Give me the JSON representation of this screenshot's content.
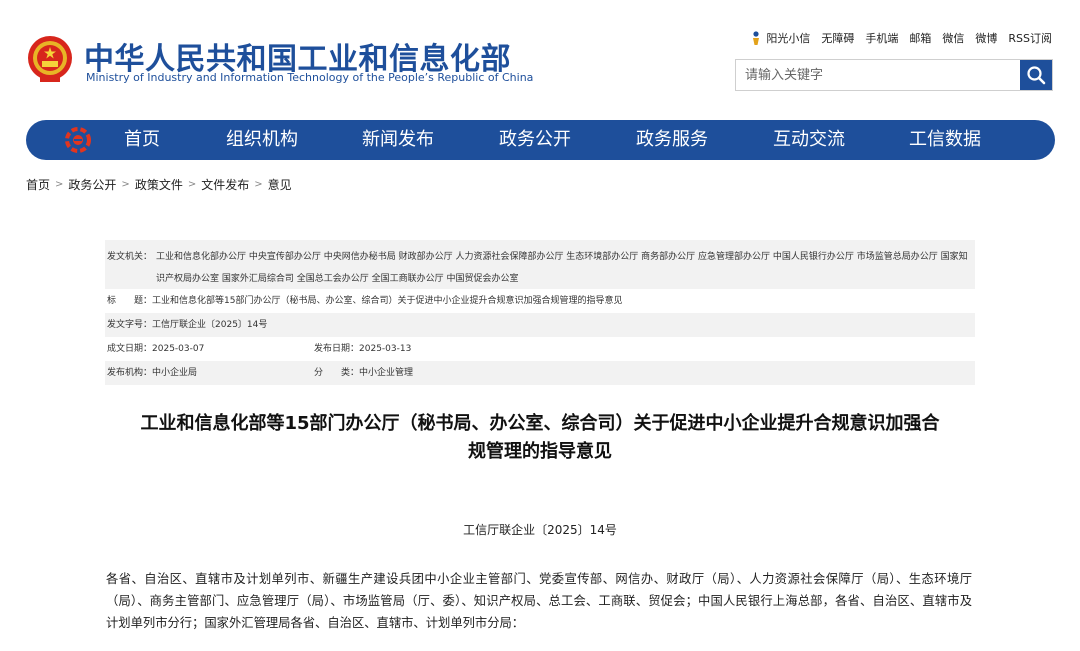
{
  "header": {
    "title_cn": "中华人民共和国工业和信息化部",
    "title_en": "Ministry of Industry and Information Technology of the People’s Republic of China",
    "top_links": [
      "阳光小信",
      "无障碍",
      "手机端",
      "邮箱",
      "微信",
      "微博",
      "RSS订阅"
    ],
    "search_placeholder": "请输入关键字",
    "brand_color": "#1e4f9b"
  },
  "nav": {
    "items": [
      "首页",
      "组织机构",
      "新闻发布",
      "政务公开",
      "政务服务",
      "互动交流",
      "工信数据"
    ]
  },
  "breadcrumb": [
    "首页",
    "政务公开",
    "政策文件",
    "文件发布",
    "意见"
  ],
  "info": {
    "organs_label": "发文机关：",
    "organs_value": "工业和信息化部办公厅 中央宣传部办公厅 中央网信办秘书局 财政部办公厅 人力资源社会保障部办公厅 生态环境部办公厅 商务部办公厅 应急管理部办公厅 中国人民银行办公厅 市场监管总局办公厅 国家知识产权局办公室 国家外汇局综合司 全国总工会办公厅 全国工商联办公厅 中国贸促会办公室",
    "title_label": "标　　题：",
    "title_value": "工业和信息化部等15部门办公厅（秘书局、办公室、综合司）关于促进中小企业提升合规意识加强合规管理的指导意见",
    "docno_label": "发文字号：",
    "docno_value": "工信厅联企业〔2025〕14号",
    "written_label": "成文日期：",
    "written_value": "2025-03-07",
    "published_label": "发布日期：",
    "published_value": "2025-03-13",
    "agency_label": "发布机构：",
    "agency_value": "中小企业局",
    "category_label": "分　　类：",
    "category_value": "中小企业管理"
  },
  "document": {
    "title_line1": "工业和信息化部等15部门办公厅（秘书局、办公室、综合司）关于促进中小企业提升合规意识加强合",
    "title_line2": "规管理的指导意见",
    "number": "工信厅联企业〔2025〕14号",
    "addressees": "各省、自治区、直辖市及计划单列市、新疆生产建设兵团中小企业主管部门、党委宣传部、网信办、财政厅（局）、人力资源社会保障厅（局）、生态环境厅（局）、商务主管部门、应急管理厅（局）、市场监管局（厅、委）、知识产权局、总工会、工商联、贸促会；中国人民银行上海总部，各省、自治区、直辖市及计划单列市分行；国家外汇管理局各省、自治区、直辖市、计划单列市分局："
  }
}
